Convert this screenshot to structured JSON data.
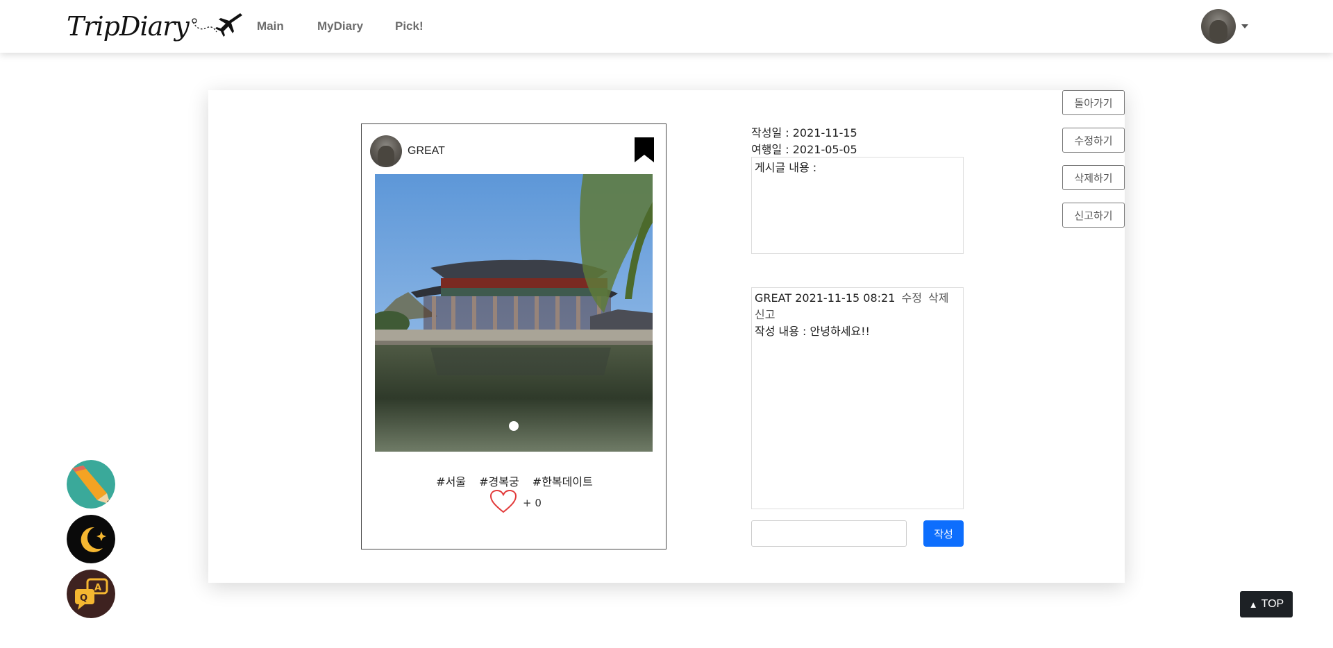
{
  "brand": {
    "name": "TripDiary"
  },
  "nav": {
    "main": "Main",
    "mydiary": "MyDiary",
    "pick": "Pick!"
  },
  "post": {
    "username": "GREAT",
    "tags": [
      "#서울",
      "#경복궁",
      "#한복데이트"
    ],
    "like_prefix": "+",
    "like_count": "0"
  },
  "meta": {
    "created_label": "작성일 : 2021-11-15",
    "travel_label": "여행일 : 2021-05-05"
  },
  "content": {
    "label": "게시글 내용 :"
  },
  "comment": {
    "user": "GREAT",
    "datetime": "2021-11-15 08:21",
    "edit": "수정",
    "delete": "삭제",
    "report": "신고",
    "text": "작성 내용 : 안녕하세요!!"
  },
  "comment_form": {
    "input_value": "",
    "submit_label": "작성"
  },
  "side_buttons": {
    "back": "돌아가기",
    "edit": "수정하기",
    "delete": "삭제하기",
    "report": "신고하기"
  },
  "top_button": {
    "label": "TOP"
  },
  "icons": {
    "fab1": "pencil-icon",
    "fab2": "moon-icon",
    "fab3": "qa-chat-icon",
    "bookmark": "bookmark-icon",
    "like": "heart-icon"
  },
  "colors": {
    "primary": "#0d6efd",
    "top_bg": "#1d2125",
    "heart": "#e23b3b"
  }
}
